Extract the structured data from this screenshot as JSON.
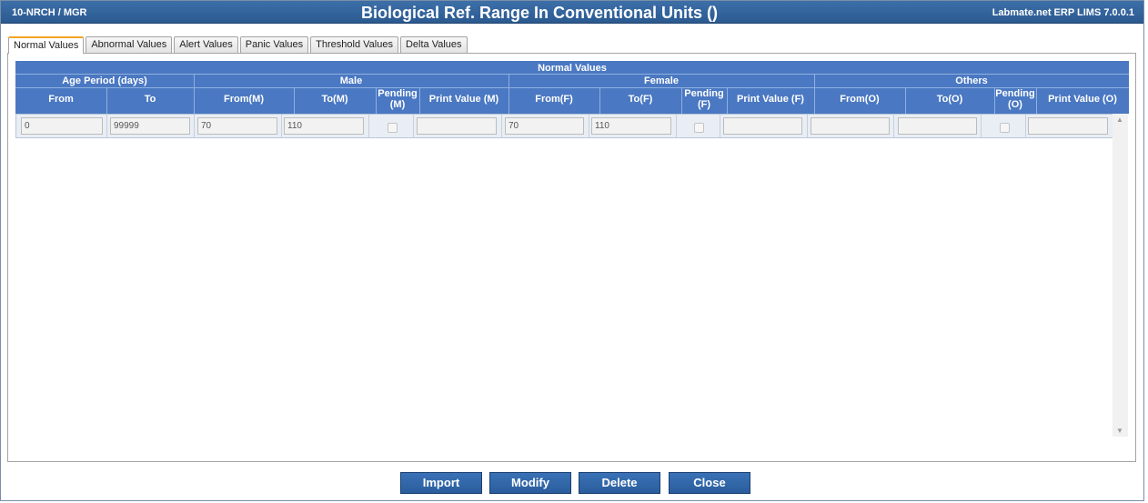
{
  "titlebar": {
    "left": "10-NRCH / MGR",
    "title": "Biological Ref. Range In Conventional Units ()",
    "right": "Labmate.net ERP LIMS 7.0.0.1"
  },
  "tabs": [
    "Normal Values",
    "Abnormal Values",
    "Alert Values",
    "Panic Values",
    "Threshold Values",
    "Delta Values"
  ],
  "grid": {
    "caption": "Normal Values",
    "groups": [
      "Age Period (days)",
      "Male",
      "Female",
      "Others"
    ],
    "columns": [
      "From",
      "To",
      "From(M)",
      "To(M)",
      "Pending (M)",
      "Print Value (M)",
      "From(F)",
      "To(F)",
      "Pending (F)",
      "Print Value (F)",
      "From(O)",
      "To(O)",
      "Pending (O)",
      "Print Value (O)"
    ],
    "row": {
      "from": "0",
      "to": "99999",
      "from_m": "70",
      "to_m": "110",
      "print_m": "",
      "from_f": "70",
      "to_f": "110",
      "print_f": "",
      "from_o": "",
      "to_o": "",
      "print_o": ""
    }
  },
  "buttons": {
    "import": "Import",
    "modify": "Modify",
    "delete": "Delete",
    "close": "Close"
  },
  "colors": {
    "titlebar": "#2b5a91",
    "grid_header": "#4a78c2",
    "active_tab_accent": "#f2a423",
    "button": "#2a5d9c"
  }
}
